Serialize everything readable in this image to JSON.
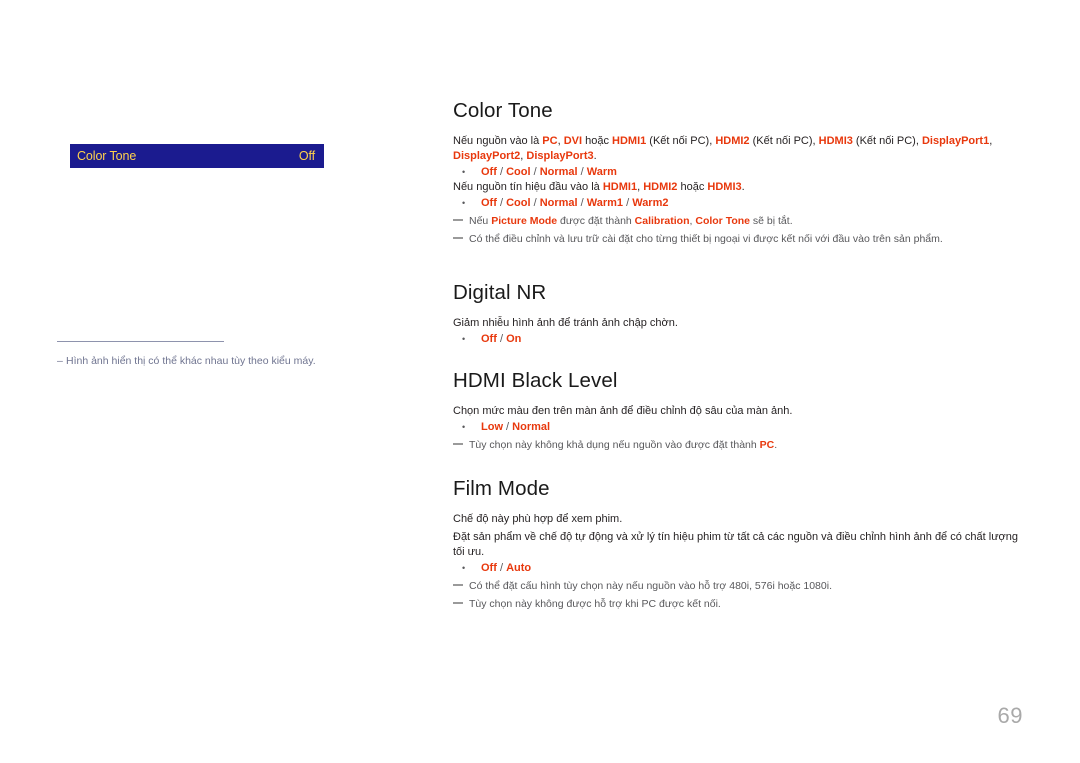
{
  "osd": {
    "label": "Color Tone",
    "value": "Off"
  },
  "left_note": {
    "dash": "–",
    "text": "Hình ảnh hiển thị có thể khác nhau tùy theo kiểu máy."
  },
  "sections": {
    "color_tone": {
      "title": "Color Tone",
      "intro_line1_a": "Nếu nguồn vào là ",
      "intro_pc": "PC",
      "intro_sep1": ", ",
      "intro_dvi": "DVI",
      "intro_hoac": " hoặc ",
      "intro_hdmi1": "HDMI1",
      "intro_kn1": " (Kết nối PC), ",
      "intro_hdmi2": "HDMI2",
      "intro_kn2": " (Kết nối PC), ",
      "intro_hdmi3": "HDMI3",
      "intro_kn3": " (Kết nối PC),",
      "intro_dp1": "DisplayPort1",
      "intro_dpsep1": ", ",
      "intro_dp2": "DisplayPort2",
      "intro_dpsep2": ", ",
      "intro_dp3": "DisplayPort3",
      "intro_dpend": ".",
      "options_1": "Off / Cool / Normal / Warm",
      "intro2_a": "Nếu nguồn tín hiệu đầu vào là ",
      "intro2_hdmi1": "HDMI1",
      "intro2_sep": ", ",
      "intro2_hdmi2": "HDMI2",
      "intro2_hoac": " hoặc ",
      "intro2_hdmi3": "HDMI3",
      "intro2_end": ".",
      "options_2": "Off / Cool / Normal / Warm1 / Warm2",
      "note1_a": "Nếu ",
      "note1_picture_mode": "Picture Mode",
      "note1_b": " được đặt thành ",
      "note1_calibration": "Calibration",
      "note1_c": ", ",
      "note1_colortone": "Color Tone",
      "note1_d": " sẽ bị tắt.",
      "note2": "Có thể điều chỉnh và lưu trữ cài đặt cho từng thiết bị ngoại vi được kết nối với đầu vào trên sản phẩm."
    },
    "digital_nr": {
      "title": "Digital NR",
      "desc": "Giảm nhiễu hình ảnh để tránh ảnh chập chờn.",
      "options": "Off / On"
    },
    "hdmi_black_level": {
      "title": "HDMI Black Level",
      "desc": "Chọn mức màu đen trên màn ảnh để điều chỉnh độ sâu của màn ảnh.",
      "options": "Low / Normal",
      "note_a": "Tùy chọn này không khả dụng nếu nguồn vào được đặt thành ",
      "note_pc": "PC",
      "note_b": "."
    },
    "film_mode": {
      "title": "Film Mode",
      "desc1": "Chế độ này phù hợp để xem phim.",
      "desc2": "Đặt sản phẩm về chế độ tự động và xử lý tín hiệu phim từ tất cả các nguồn và điều chỉnh hình ảnh để có chất lượng tối ưu.",
      "options": "Off / Auto",
      "note1": "Có thể đặt cấu hình tùy chọn này nếu nguồn vào hỗ trợ 480i, 576i hoặc 1080i.",
      "note2": "Tùy chọn này không được hỗ trợ khi PC được kết nối."
    }
  },
  "page_number": "69",
  "colors": {
    "osd_background": "#1b1b8f",
    "osd_text": "#ffd24d",
    "accent_red": "#e8380d",
    "note_gray": "#58585b",
    "left_note_blue": "#6f7490"
  }
}
